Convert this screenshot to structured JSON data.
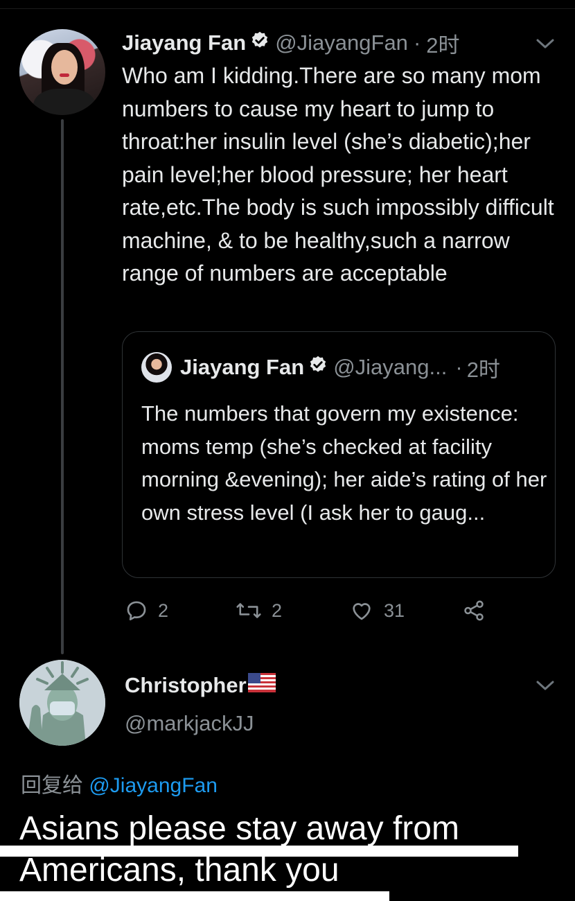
{
  "tweet": {
    "author_name": "Jiayang Fan",
    "handle": "@JiayangFan",
    "time": "2时",
    "separator": "·",
    "text": "Who am I kidding.There are so many mom numbers to cause my heart to jump to throat:her insulin level (she’s diabetic);her pain level;her blood pressure; her heart rate,etc.The body is such impossibly difficult machine, & to be healthy,such a narrow range of numbers are acceptable",
    "quote": {
      "author_name": "Jiayang Fan",
      "handle": "@Jiayang...",
      "time": "2时",
      "separator": "·",
      "text": "The numbers that govern my existence: moms temp (she’s checked at facility morning &evening); her aide’s rating of her own stress level (I ask her to gaug..."
    },
    "actions": {
      "replies": "2",
      "retweets": "2",
      "likes": "31"
    }
  },
  "reply": {
    "author_name": "Christopher",
    "handle": "@markjackJJ",
    "reply_to_label": "回复给",
    "reply_to_handle": "@JiayangFan",
    "text_line1": "Asians please stay away from",
    "text_line2": "Americans, thank you"
  },
  "icons": {
    "verified": "verified-badge-icon",
    "reply": "reply-bubble-icon",
    "retweet": "retweet-icon",
    "like": "heart-icon",
    "share": "share-icon",
    "more": "chevron-down-icon",
    "flag": "us-flag-icon"
  },
  "colors": {
    "background": "#000000",
    "text": "#e7e9ea",
    "muted": "#8b9196",
    "link": "#1d9bf0",
    "border": "#2f3336"
  }
}
